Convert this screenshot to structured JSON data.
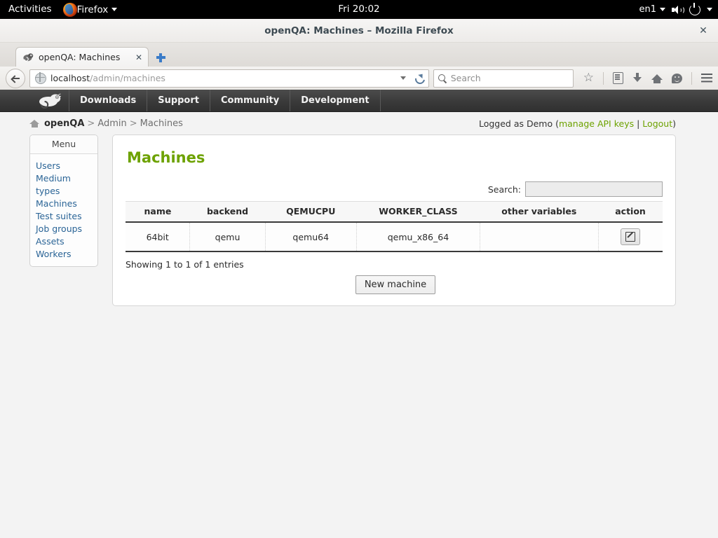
{
  "desktop": {
    "activities_label": "Activities",
    "app_name": "Firefox",
    "app_menu_icon": "firefox-logo",
    "clock": "Fri 20:02",
    "keyboard_layout": "en1",
    "volume_icon": "speaker-icon",
    "power_icon": "power-icon",
    "system_menu_caret": "chevron-down-icon"
  },
  "window": {
    "title": "openQA: Machines – Mozilla Firefox",
    "close_label": "✕"
  },
  "browser": {
    "tab": {
      "title": "openQA: Machines",
      "favicon": "openqa-geeko-favicon",
      "close_label": "✕"
    },
    "new_tab_label": "+",
    "url": {
      "host": "localhost",
      "path": "/admin/machines"
    },
    "search": {
      "placeholder": "Search"
    },
    "toolbar_icons": [
      "bookmark-star-icon",
      "reader-list-icon",
      "downloads-icon",
      "home-icon",
      "sync-smiley-icon",
      "hamburger-menu-icon"
    ]
  },
  "suse_nav": {
    "logo": "opensuse-geeko-logo",
    "items": [
      {
        "label": "Downloads"
      },
      {
        "label": "Support"
      },
      {
        "label": "Community"
      },
      {
        "label": "Development"
      }
    ]
  },
  "breadcrumb": {
    "home_icon": "home-icon",
    "root": "openQA",
    "sep1": ">",
    "section": "Admin",
    "sep2": ">",
    "current": "Machines"
  },
  "account": {
    "prefix": "Logged as Demo (",
    "api_keys_label": "manage API keys",
    "divider": " | ",
    "logout_label": "Logout",
    "suffix": ")"
  },
  "sidebar": {
    "header": "Menu",
    "items": [
      {
        "label": "Users"
      },
      {
        "label": "Medium types"
      },
      {
        "label": "Machines"
      },
      {
        "label": "Test suites"
      },
      {
        "label": "Job groups"
      },
      {
        "label": "Assets"
      },
      {
        "label": "Workers"
      }
    ]
  },
  "main": {
    "title": "Machines",
    "search_label": "Search:",
    "search_value": "",
    "search_placeholder": "",
    "table": {
      "columns": [
        "name",
        "backend",
        "QEMUCPU",
        "WORKER_CLASS",
        "other variables",
        "action"
      ],
      "rows": [
        {
          "name": "64bit",
          "backend": "qemu",
          "qemucpu": "qemu64",
          "worker_class": "qemu_x86_64",
          "other_variables": "",
          "action_icon": "edit-pencil-icon"
        }
      ]
    },
    "entries_text": "Showing 1 to 1 of 1 entries",
    "new_machine_label": "New machine"
  },
  "colors": {
    "accent_green": "#6da200",
    "link_blue": "#2a6496",
    "nav_dark": "#3a3a3a"
  }
}
